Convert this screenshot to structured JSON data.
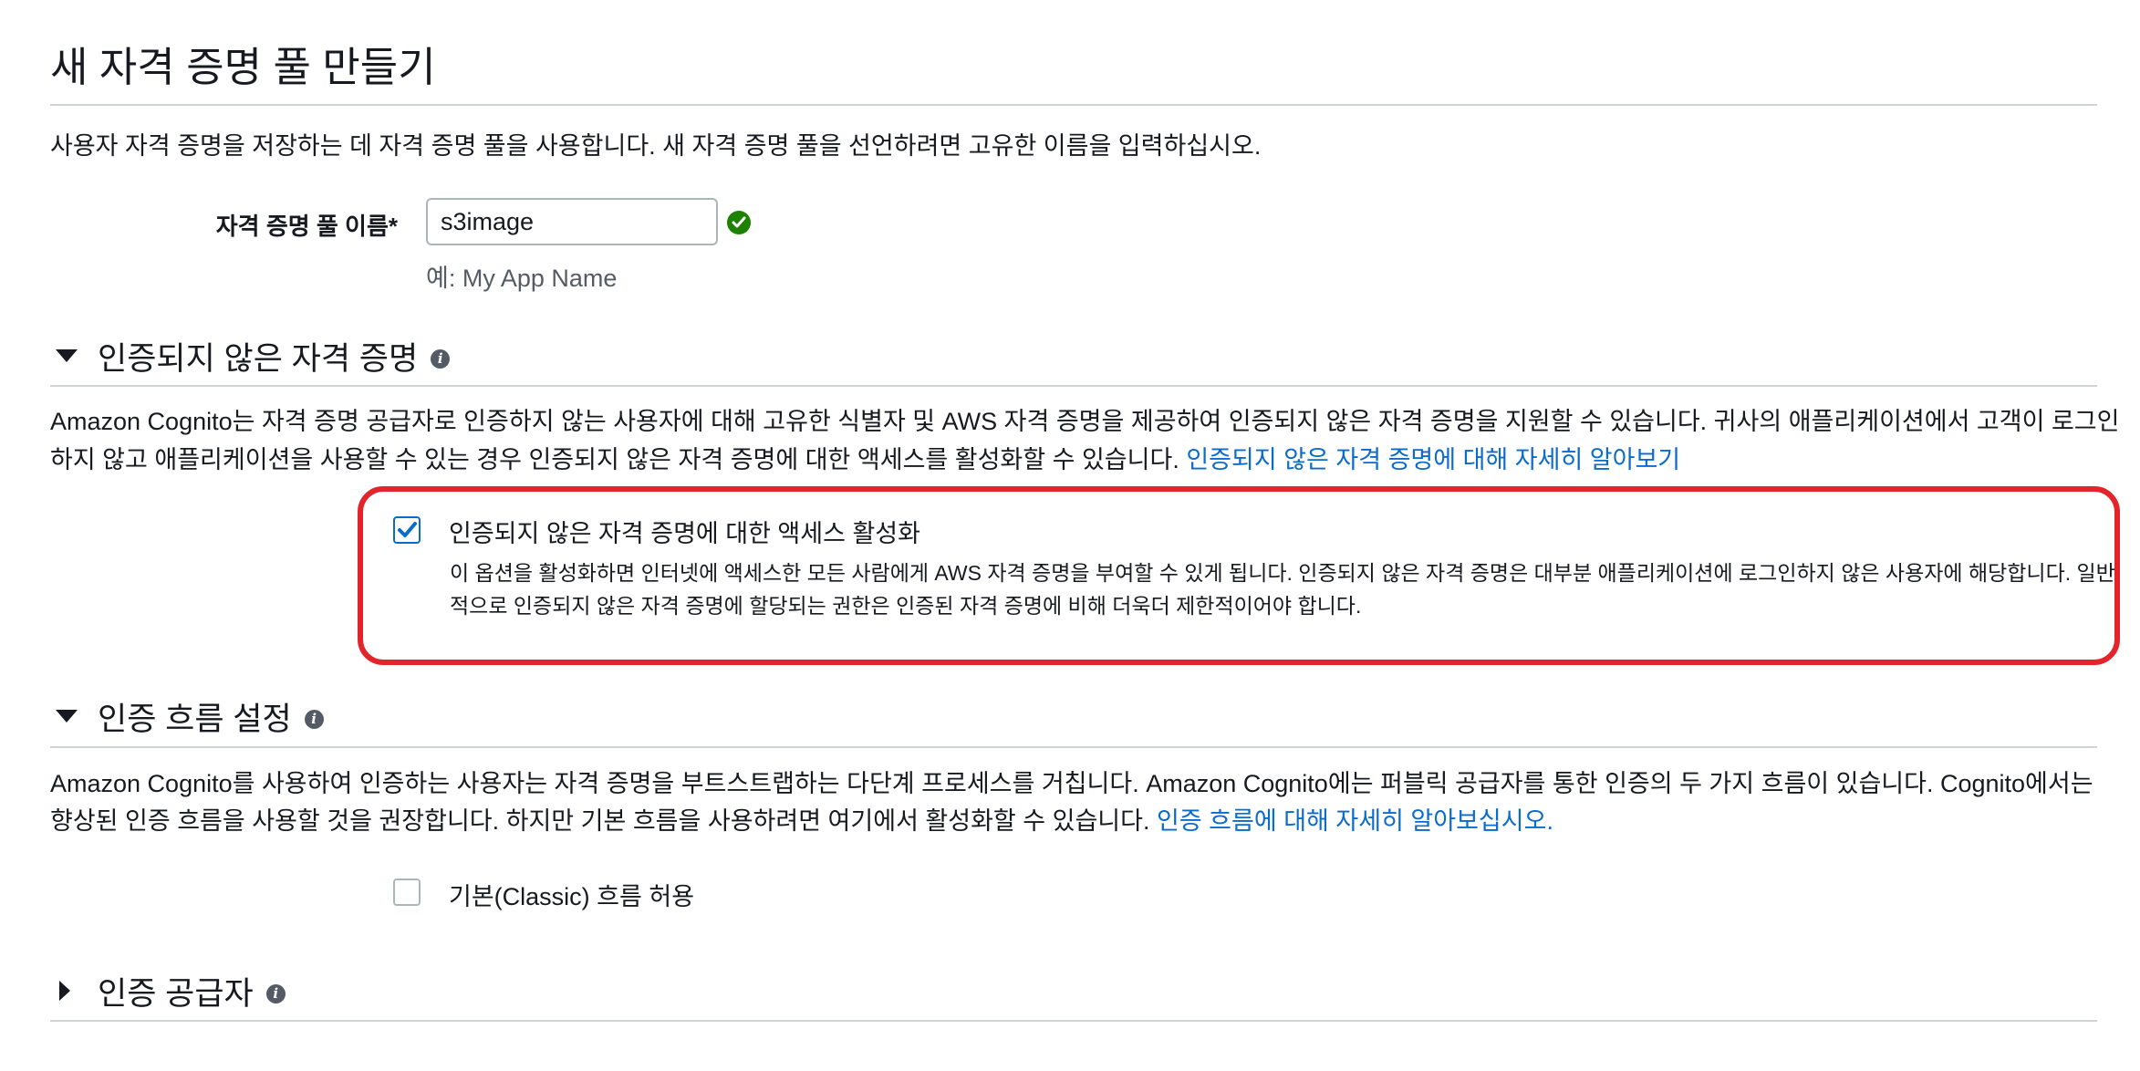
{
  "header": {
    "title": "새 자격 증명 풀 만들기",
    "description": "사용자 자격 증명을 저장하는 데 자격 증명 풀을 사용합니다. 새 자격 증명 풀을 선언하려면 고유한 이름을 입력하십시오."
  },
  "pool_name": {
    "label": "자격 증명 풀 이름*",
    "value": "s3image",
    "hint": "예: My App Name",
    "status_icon": "check-circle-icon",
    "status_color": "#1d8102"
  },
  "unauth_section": {
    "title": "인증되지 않은 자격 증명",
    "expanded": true,
    "desc_line1": "Amazon Cognito는 자격 증명 공급자로 인증하지 않는 사용자에 대해 고유한 식별자 및 AWS 자격 증명을 제공하여 인증되지 않은 자격 증명을 지원할 수 있습니다. 귀사의 애플리케이션에서 고객이 로그인",
    "desc_line2": "하지 않고 애플리케이션을 사용할 수 있는 경우 인증되지 않은 자격 증명에 대한 액세스를 활성화할 수 있습니다.",
    "link": "인증되지 않은 자격 증명에 대해 자세히 알아보기",
    "checkbox_label": "인증되지 않은 자격 증명에 대한 액세스 활성화",
    "checkbox_checked": true,
    "checkbox_desc_line1": "이 옵션을 활성화하면 인터넷에 액세스한 모든 사람에게 AWS 자격 증명을 부여할 수 있게 됩니다. 인증되지 않은 자격 증명은 대부분 애플리케이션에 로그인하지 않은 사용자에 해당합니다. 일반",
    "checkbox_desc_line2": "적으로 인증되지 않은 자격 증명에 할당되는 권한은 인증된 자격 증명에 비해 더욱더 제한적이어야 합니다."
  },
  "auth_flow_section": {
    "title": "인증 흐름 설정",
    "expanded": true,
    "desc_line1": "Amazon Cognito를 사용하여 인증하는 사용자는 자격 증명을 부트스트랩하는 다단계 프로세스를 거칩니다. Amazon Cognito에는 퍼블릭 공급자를 통한 인증의 두 가지 흐름이 있습니다. Cognito에서는",
    "desc_line2": "향상된 인증 흐름을 사용할 것을 권장합니다. 하지만 기본 흐름을 사용하려면 여기에서 활성화할 수 있습니다.",
    "link": "인증 흐름에 대해 자세히 알아보십시오.",
    "checkbox_label": "기본(Classic) 흐름 허용",
    "checkbox_checked": false
  },
  "auth_providers_section": {
    "title": "인증 공급자",
    "expanded": false
  },
  "colors": {
    "link": "#0b6bcb",
    "checkbox_checked": "#0b6bcb",
    "highlight": "#e3242b"
  }
}
